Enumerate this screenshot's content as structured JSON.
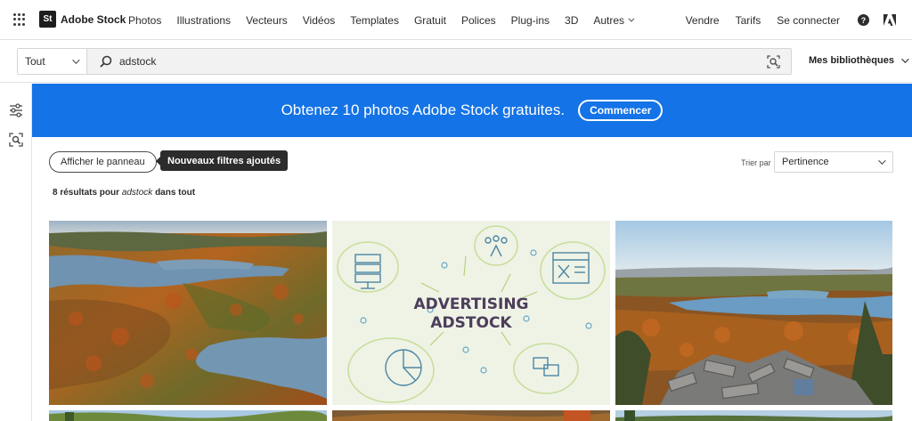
{
  "header": {
    "brand_logo": "St",
    "brand_name": "Adobe Stock",
    "nav": [
      "Photos",
      "Illustrations",
      "Vecteurs",
      "Vidéos",
      "Templates",
      "Gratuit",
      "Polices",
      "Plug-ins",
      "3D"
    ],
    "more_label": "Autres",
    "right": [
      "Vendre",
      "Tarifs",
      "Se connecter"
    ],
    "help_glyph": "?"
  },
  "search": {
    "scope": "Tout",
    "query": "adstock",
    "libraries_label": "Mes bibliothèques"
  },
  "banner": {
    "text": "Obtenez 10 photos Adobe Stock gratuites.",
    "button": "Commencer",
    "color": "#1473e6"
  },
  "filters": {
    "panel_button": "Afficher le panneau",
    "tooltip": "Nouveaux filtres ajoutés",
    "sort_label": "Trier par",
    "sort_value": "Pertinence"
  },
  "results": {
    "count_text": "8 résultats pour",
    "query": "adstock",
    "suffix": "dans tout"
  },
  "illustration": {
    "line1": "ADVERTISING",
    "line2": "ADSTOCK"
  },
  "icons": {
    "apps": "apps-grid-icon",
    "search": "search-icon",
    "visual_search": "visual-search-icon",
    "filters": "filters-icon",
    "rail_visual": "visual-search-icon",
    "adobe": "adobe-logo-icon"
  }
}
